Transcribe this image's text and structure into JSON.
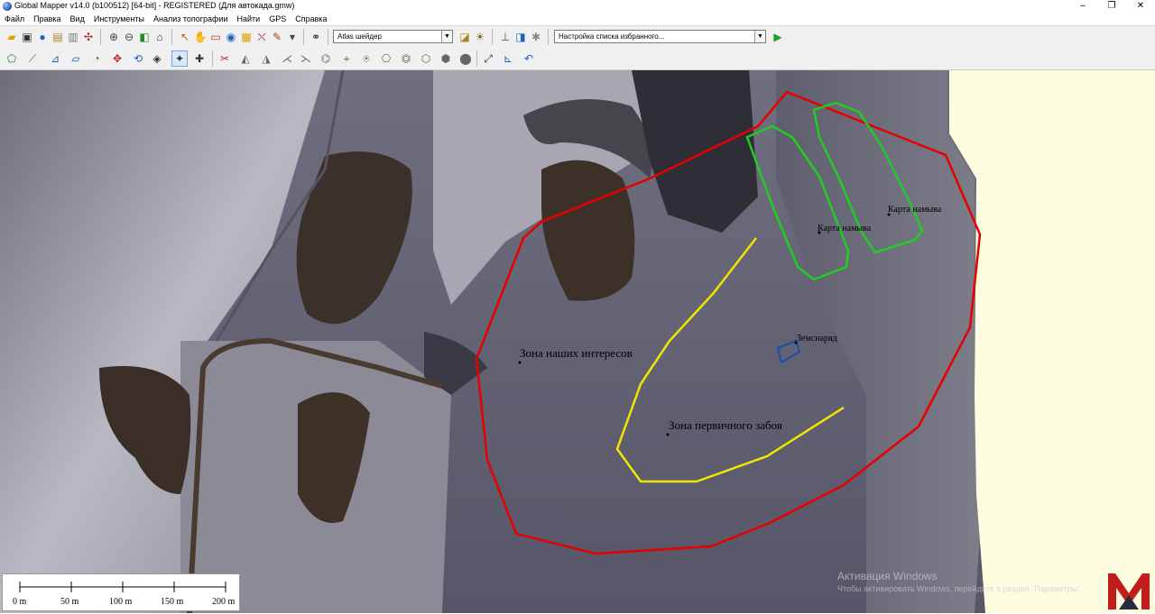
{
  "window": {
    "title": "Global Mapper v14.0 (b100512) [64-bit] - REGISTERED (Для автокада.gmw)",
    "minimize": "–",
    "restore": "❐",
    "close": "✕"
  },
  "menu": [
    "Файл",
    "Правка",
    "Вид",
    "Инструменты",
    "Анализ топографии",
    "Найти",
    "GPS",
    "Справка"
  ],
  "toolbar": {
    "shader_select": "Atlas шейдер",
    "favorites_select": "Настройка списка избранного...",
    "run_icon": "play-icon"
  },
  "map": {
    "labels": {
      "zone_interest": "Зона наших интересов",
      "zone_primary": "Зона первичного забоя",
      "dredger": "Земснаряд",
      "map_wash_1": "Карта намыва",
      "map_wash_2": "Карта намыва"
    },
    "colors": {
      "zone_interest": "#e60000",
      "zone_primary": "#f2e600",
      "map_wash": "#22cc22",
      "dredger": "#1a4fa8",
      "unmapped_area": "#fffde0"
    }
  },
  "scalebar": {
    "ticks": [
      "0 m",
      "50 m",
      "100 m",
      "150 m",
      "200 m"
    ]
  },
  "watermark": {
    "line1": "Активация Windows",
    "line2": "Чтобы активировать Windows, перейдите в раздел \"Параметры\"."
  },
  "logo": {
    "letter": "M",
    "color": "#c21d1d"
  }
}
